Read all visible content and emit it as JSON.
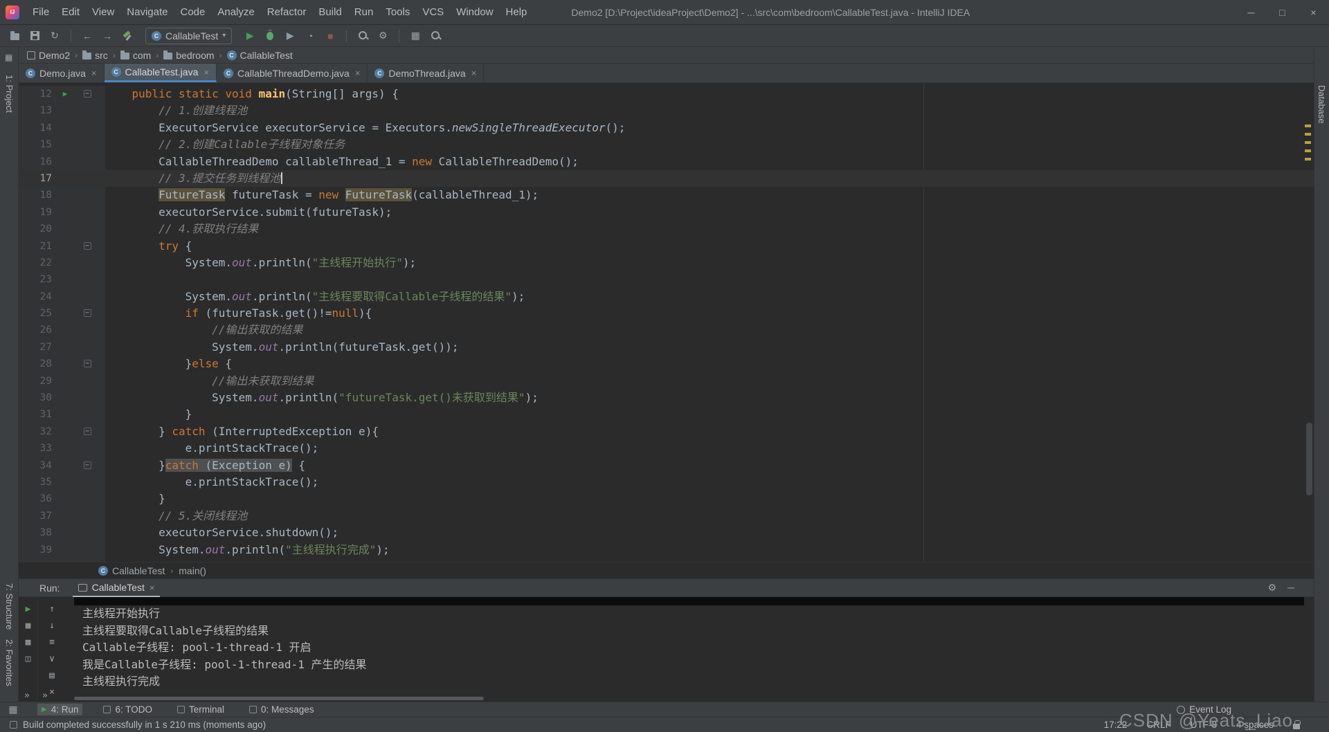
{
  "window": {
    "title": "Demo2 [D:\\Project\\ideaProject\\Demo2] - ...\\src\\com\\bedroom\\CallableTest.java - IntelliJ IDEA",
    "logo": "IJ",
    "controls": [
      {
        "name": "minimize-button",
        "glyph": "─"
      },
      {
        "name": "maximize-button",
        "glyph": "□"
      },
      {
        "name": "close-button",
        "glyph": "×"
      }
    ]
  },
  "menubar": {
    "items": [
      "File",
      "Edit",
      "View",
      "Navigate",
      "Code",
      "Analyze",
      "Refactor",
      "Build",
      "Run",
      "Tools",
      "VCS",
      "Window",
      "Help"
    ]
  },
  "toolbar": {
    "run_config": "CallableTest",
    "items": [
      {
        "name": "open-icon",
        "type": "folder"
      },
      {
        "name": "save-icon",
        "type": "floppy"
      },
      {
        "name": "sync-icon",
        "glyph": "↻"
      },
      {
        "name": "toolbar-separator",
        "type": "sep"
      },
      {
        "name": "back-icon",
        "glyph": "←"
      },
      {
        "name": "forward-icon",
        "glyph": "→"
      },
      {
        "name": "build-icon",
        "type": "hammer"
      },
      {
        "name": "run-config-combo",
        "type": "combo"
      },
      {
        "name": "run-icon",
        "glyph": "▶",
        "color": "#499c54"
      },
      {
        "name": "debug-icon",
        "type": "bug"
      },
      {
        "name": "coverage-icon",
        "glyph": "▶",
        "color": "#8a9da6"
      },
      {
        "name": "profiler-icon",
        "glyph": "◔",
        "color": "#9da2a6"
      },
      {
        "name": "stop-icon",
        "glyph": "■",
        "color": "#8c5552"
      },
      {
        "name": "toolbar-separator",
        "type": "sep"
      },
      {
        "name": "search-icon",
        "type": "mag"
      },
      {
        "name": "settings-icon",
        "glyph": "⚙"
      },
      {
        "name": "toolbar-separator",
        "type": "sep"
      },
      {
        "name": "layout-icon",
        "glyph": "▦"
      },
      {
        "name": "find-icon",
        "type": "mag"
      }
    ]
  },
  "breadcrumbs": {
    "items": [
      {
        "label": "Demo2",
        "icon": "module"
      },
      {
        "label": "src",
        "icon": "folder"
      },
      {
        "label": "com",
        "icon": "folder"
      },
      {
        "label": "bedroom",
        "icon": "folder"
      },
      {
        "label": "CallableTest",
        "icon": "class"
      }
    ]
  },
  "tabs": [
    {
      "label": "Demo.java",
      "active": false
    },
    {
      "label": "CallableTest.java",
      "active": true
    },
    {
      "label": "CallableThreadDemo.java",
      "active": false
    },
    {
      "label": "DemoThread.java",
      "active": false
    }
  ],
  "editor": {
    "gutter_icons": {
      "run": "▶",
      "fold": "−"
    },
    "lines": [
      {
        "n": 12,
        "ind": 4,
        "run": true,
        "fold": true,
        "seg": [
          [
            "kw",
            "public static void "
          ],
          [
            "fn",
            "main"
          ],
          [
            "pl",
            "(String[] args) {"
          ]
        ]
      },
      {
        "n": 13,
        "ind": 8,
        "seg": [
          [
            "cm",
            "// 1.创建线程池"
          ]
        ]
      },
      {
        "n": 14,
        "ind": 8,
        "seg": [
          [
            "pl",
            "ExecutorService executorService = Executors."
          ],
          [
            "it",
            "newSingleThreadExecutor"
          ],
          [
            "pl",
            "();"
          ]
        ]
      },
      {
        "n": 15,
        "ind": 8,
        "seg": [
          [
            "cm",
            "// 2.创建Callable子线程对象任务"
          ]
        ]
      },
      {
        "n": 16,
        "ind": 8,
        "seg": [
          [
            "pl",
            "CallableThreadDemo callableThread_1 = "
          ],
          [
            "kw",
            "new"
          ],
          [
            "pl",
            " CallableThreadDemo();"
          ]
        ]
      },
      {
        "n": 17,
        "ind": 8,
        "current": true,
        "caret": true,
        "seg": [
          [
            "cm",
            "// 3.提交任务到线程池"
          ]
        ]
      },
      {
        "n": 18,
        "ind": 8,
        "seg": [
          [
            "hl",
            "FutureTask"
          ],
          [
            "pl",
            " futureTask = "
          ],
          [
            "kw",
            "new"
          ],
          [
            "pl",
            " "
          ],
          [
            "hl",
            "FutureTask"
          ],
          [
            "pl",
            "(callableThread_1);"
          ]
        ]
      },
      {
        "n": 19,
        "ind": 8,
        "seg": [
          [
            "pl",
            "executorService.submit(futureTask);"
          ]
        ]
      },
      {
        "n": 20,
        "ind": 8,
        "seg": [
          [
            "cm",
            "// 4.获取执行结果"
          ]
        ]
      },
      {
        "n": 21,
        "ind": 8,
        "fold": true,
        "seg": [
          [
            "kw",
            "try"
          ],
          [
            "pl",
            " {"
          ]
        ]
      },
      {
        "n": 22,
        "ind": 12,
        "seg": [
          [
            "pl",
            "System."
          ],
          [
            "fd",
            "out"
          ],
          [
            "pl",
            ".println("
          ],
          [
            "st",
            "\"主线程开始执行\""
          ],
          [
            "pl",
            ");"
          ]
        ]
      },
      {
        "n": 23,
        "seg": []
      },
      {
        "n": 24,
        "ind": 12,
        "seg": [
          [
            "pl",
            "System."
          ],
          [
            "fd",
            "out"
          ],
          [
            "pl",
            ".println("
          ],
          [
            "st",
            "\"主线程要取得Callable子线程的结果\""
          ],
          [
            "pl",
            ");"
          ]
        ]
      },
      {
        "n": 25,
        "ind": 12,
        "fold": true,
        "seg": [
          [
            "kw",
            "if"
          ],
          [
            "pl",
            " (futureTask.get()!="
          ],
          [
            "kw",
            "null"
          ],
          [
            "pl",
            "){"
          ]
        ]
      },
      {
        "n": 26,
        "ind": 16,
        "seg": [
          [
            "cm",
            "//输出获取的结果"
          ]
        ]
      },
      {
        "n": 27,
        "ind": 16,
        "seg": [
          [
            "pl",
            "System."
          ],
          [
            "fd",
            "out"
          ],
          [
            "pl",
            ".println(futureTask.get());"
          ]
        ]
      },
      {
        "n": 28,
        "ind": 12,
        "fold": true,
        "seg": [
          [
            "pl",
            "}"
          ],
          [
            "kw",
            "else"
          ],
          [
            "pl",
            " {"
          ]
        ]
      },
      {
        "n": 29,
        "ind": 16,
        "seg": [
          [
            "cm",
            "//输出未获取到结果"
          ]
        ]
      },
      {
        "n": 30,
        "ind": 16,
        "seg": [
          [
            "pl",
            "System."
          ],
          [
            "fd",
            "out"
          ],
          [
            "pl",
            ".println("
          ],
          [
            "st",
            "\"futureTask.get()未获取到结果\""
          ],
          [
            "pl",
            ");"
          ]
        ]
      },
      {
        "n": 31,
        "ind": 12,
        "seg": [
          [
            "pl",
            "}"
          ]
        ]
      },
      {
        "n": 32,
        "ind": 8,
        "fold": true,
        "seg": [
          [
            "pl",
            "} "
          ],
          [
            "kw",
            "catch"
          ],
          [
            "pl",
            " (InterruptedException e){"
          ]
        ]
      },
      {
        "n": 33,
        "ind": 12,
        "seg": [
          [
            "pl",
            "e.printStackTrace();"
          ]
        ]
      },
      {
        "n": 34,
        "ind": 8,
        "fold": true,
        "seg": [
          [
            "pl",
            "}"
          ],
          [
            "sk",
            "catch"
          ],
          [
            "se",
            " (Exception e)"
          ],
          [
            "pl",
            " {"
          ]
        ]
      },
      {
        "n": 35,
        "ind": 12,
        "seg": [
          [
            "pl",
            "e.printStackTrace();"
          ]
        ]
      },
      {
        "n": 36,
        "ind": 8,
        "seg": [
          [
            "pl",
            "}"
          ]
        ]
      },
      {
        "n": 37,
        "ind": 8,
        "seg": [
          [
            "cm",
            "// 5.关闭线程池"
          ]
        ]
      },
      {
        "n": 38,
        "ind": 8,
        "seg": [
          [
            "pl",
            "executorService.shutdown();"
          ]
        ]
      },
      {
        "n": 39,
        "ind": 8,
        "seg": [
          [
            "pl",
            "System."
          ],
          [
            "fd",
            "out"
          ],
          [
            "pl",
            ".println("
          ],
          [
            "st",
            "\"主线程执行完成\""
          ],
          [
            "pl",
            ");"
          ]
        ]
      },
      {
        "n": 40,
        "seg": []
      }
    ]
  },
  "nav_footer": {
    "items": [
      "CallableTest",
      "main()"
    ]
  },
  "run_panel": {
    "label": "Run:",
    "tab": "CallableTest",
    "tab_close": "×",
    "header_icons": [
      {
        "name": "settings-icon",
        "glyph": "⚙"
      },
      {
        "name": "hide-panel-icon",
        "glyph": "─"
      }
    ],
    "left_icons": [
      {
        "name": "rerun-icon",
        "glyph": "▶",
        "color": "#499c54"
      },
      {
        "name": "stop-icon",
        "glyph": "■",
        "color": "#888888"
      },
      {
        "name": "restore-layout-icon",
        "glyph": "▦"
      },
      {
        "name": "pin-tab-icon",
        "glyph": "◫"
      }
    ],
    "console_icons": [
      {
        "name": "up-stack-icon",
        "glyph": "↑"
      },
      {
        "name": "down-stack-icon",
        "glyph": "↓"
      },
      {
        "name": "soft-wrap-icon",
        "glyph": "≡"
      },
      {
        "name": "scroll-to-end-icon",
        "glyph": "∨"
      },
      {
        "name": "print-icon",
        "glyph": "▤"
      },
      {
        "name": "clear-console-icon",
        "glyph": "×"
      }
    ],
    "overflow_chevrons": [
      "»",
      "»"
    ],
    "output": [
      "主线程开始执行",
      "主线程要取得Callable子线程的结果",
      "Callable子线程: pool-1-thread-1 开启",
      "我是Callable子线程: pool-1-thread-1 产生的结果",
      "主线程执行完成"
    ]
  },
  "tool_strips": {
    "left": [
      {
        "key": "project",
        "label": "1: Project"
      },
      {
        "key": "structure",
        "label": "7: Structure"
      },
      {
        "key": "favorites",
        "label": "2: Favorites"
      }
    ],
    "right": [
      {
        "key": "database",
        "label": "Database"
      }
    ],
    "bottom_left": [
      {
        "label": "4: Run",
        "glyph": "▶",
        "green": true,
        "active": true
      },
      {
        "label": "6: TODO"
      },
      {
        "label": "Terminal"
      },
      {
        "label": "0: Messages"
      }
    ],
    "bottom_right": [
      {
        "label": "Event Log"
      }
    ]
  },
  "status_bar": {
    "message": "Build completed successfully in 1 s 210 ms (moments ago)",
    "right_items": [
      {
        "name": "clock-indicator",
        "label": "17:22"
      },
      {
        "name": "line-ending-indicator",
        "label": "CRLF"
      },
      {
        "name": "encoding-indicator",
        "label": "UTF-8"
      },
      {
        "name": "indent-indicator",
        "label": "4 spaces"
      }
    ]
  },
  "watermark": "CSDN @Yeats_Liao",
  "colors": {
    "keyword": "#cc7832",
    "string": "#6a8759",
    "comment": "#808080",
    "field": "#9876aa",
    "method": "#ffc66b",
    "run_green": "#499c54",
    "active_tab_underline": "#4a88c7",
    "error_stripe": "#b8a13a",
    "occurrence_highlight": "#5a523b",
    "selection_highlight": "#4e5052"
  }
}
